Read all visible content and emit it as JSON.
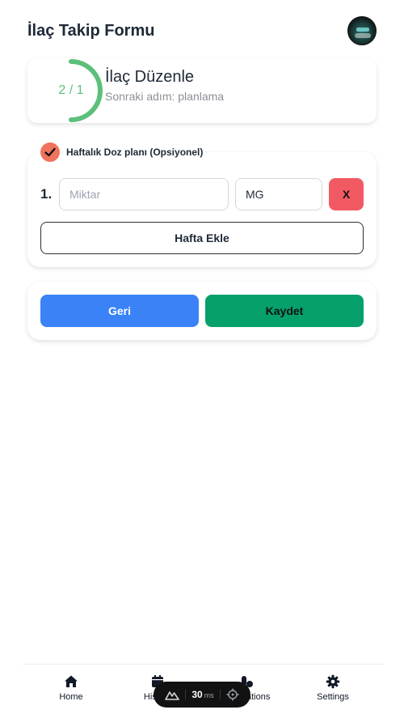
{
  "header": {
    "title": "İlaç Takip Formu"
  },
  "step": {
    "progress_label": "2 / 1",
    "title": "İlaç Düzenle",
    "subtitle": "Sonraki adım: planlama",
    "accent": "#5cc07a"
  },
  "dose_plan": {
    "label": "Haftalık Doz planı (Opsiyonel)",
    "checked": true,
    "rows": [
      {
        "number": "1.",
        "quantity_placeholder": "Miktar",
        "unit_value": "MG",
        "remove_label": "X"
      }
    ],
    "add_week_label": "Hafta Ekle"
  },
  "actions": {
    "back_label": "Geri",
    "save_label": "Kaydet"
  },
  "bottom_nav": {
    "items": [
      {
        "label": "Home",
        "icon": "home-icon"
      },
      {
        "label": "History",
        "icon": "calendar-icon"
      },
      {
        "label": "Medications",
        "icon": "pills-icon"
      },
      {
        "label": "Settings",
        "icon": "gear-icon"
      }
    ]
  },
  "devbar": {
    "ms_value": "30",
    "ms_unit": "ms"
  },
  "colors": {
    "primary_blue": "#3b82f6",
    "success_green": "#06a06b",
    "danger_red": "#f25a63",
    "check_orange": "#f0735d"
  }
}
